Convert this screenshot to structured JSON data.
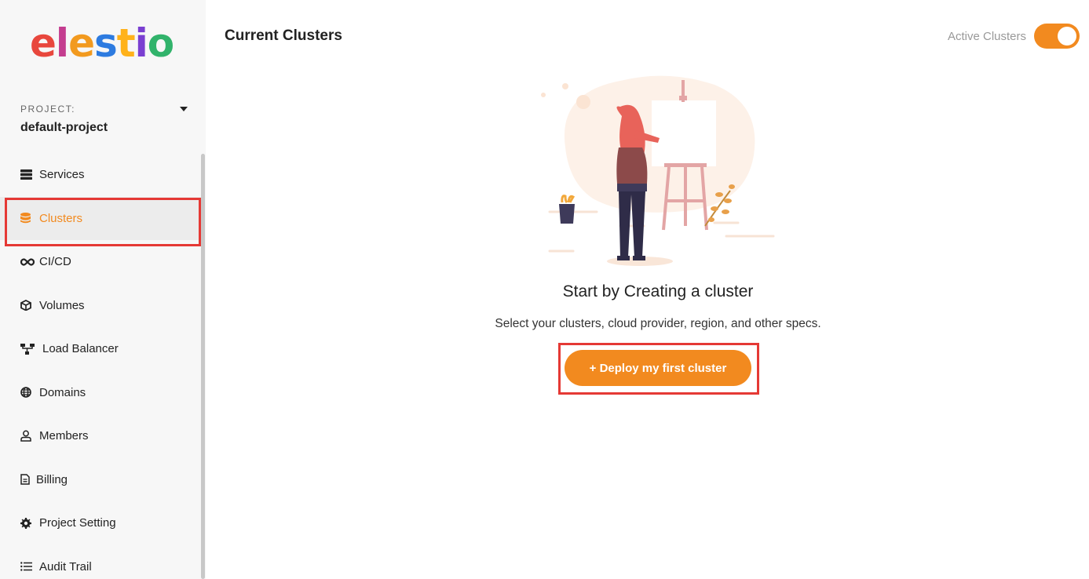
{
  "brand": {
    "logo_letters": [
      "e",
      "l",
      "e",
      "s",
      "t",
      "i",
      "o"
    ],
    "logo_colors": [
      "#e8473d",
      "#c43d8f",
      "#f29a1f",
      "#2d7be0",
      "#ffb21a",
      "#7a3fd1",
      "#31b36b"
    ]
  },
  "project": {
    "label": "PROJECT:",
    "name": "default-project"
  },
  "sidebar": {
    "items": [
      {
        "label": "Services",
        "icon": "server-icon"
      },
      {
        "label": "Clusters",
        "icon": "database-icon",
        "active": true
      },
      {
        "label": "CI/CD",
        "icon": "infinity-icon"
      },
      {
        "label": "Volumes",
        "icon": "cube-icon"
      },
      {
        "label": "Load Balancer",
        "icon": "network-icon"
      },
      {
        "label": "Domains",
        "icon": "globe-icon"
      },
      {
        "label": "Members",
        "icon": "user-icon"
      },
      {
        "label": "Billing",
        "icon": "document-icon"
      },
      {
        "label": "Project Setting",
        "icon": "gear-icon"
      },
      {
        "label": "Audit Trail",
        "icon": "list-icon"
      }
    ]
  },
  "header": {
    "title": "Current Clusters",
    "toggle_label": "Active Clusters",
    "toggle_on": true
  },
  "empty_state": {
    "title": "Start by Creating a cluster",
    "subtitle": "Select your clusters, cloud provider, region, and other specs.",
    "cta_label": "+ Deploy my first cluster",
    "illustration": "woman-painting-easel-illustration"
  },
  "colors": {
    "accent": "#f28a1f",
    "highlight_box": "#e53935",
    "sidebar_bg": "#f7f7f7"
  }
}
